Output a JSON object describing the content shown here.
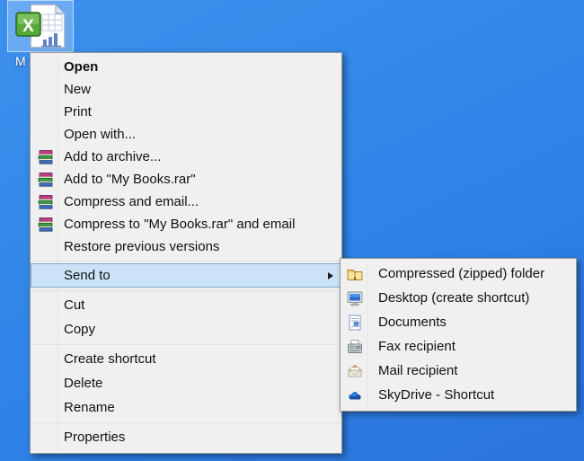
{
  "desktop": {
    "icon_label_visible": "M",
    "icon_type": "excel-document",
    "background_blue": "#2f85e8"
  },
  "colors": {
    "menu_background": "#f1f0f0",
    "menu_border": "#979797",
    "highlight_fill": "#cbe2f7",
    "highlight_border": "#7fa8d0",
    "selection_fill": "rgba(160,205,250,0.45)"
  },
  "context_menu": {
    "items": [
      {
        "label": "Open",
        "bold": true
      },
      {
        "label": "New"
      },
      {
        "label": "Print"
      },
      {
        "label": "Open with..."
      },
      {
        "label": "Add to archive...",
        "icon": "winrar-books-icon"
      },
      {
        "label": "Add to \"My Books.rar\"",
        "icon": "winrar-books-icon"
      },
      {
        "label": "Compress and email...",
        "icon": "winrar-books-icon"
      },
      {
        "label": "Compress to \"My Books.rar\" and email",
        "icon": "winrar-books-icon"
      },
      {
        "label": "Restore previous versions"
      },
      {
        "type": "separator"
      },
      {
        "label": "Send to",
        "highlighted": true,
        "has_submenu": true
      },
      {
        "type": "separator"
      },
      {
        "label": "Cut"
      },
      {
        "label": "Copy"
      },
      {
        "type": "separator"
      },
      {
        "label": "Create shortcut"
      },
      {
        "label": "Delete"
      },
      {
        "label": "Rename"
      },
      {
        "type": "separator"
      },
      {
        "label": "Properties"
      }
    ]
  },
  "submenu": {
    "items": [
      {
        "label": "Compressed (zipped) folder",
        "icon": "zip-folder-icon"
      },
      {
        "label": "Desktop (create shortcut)",
        "icon": "desktop-monitor-icon"
      },
      {
        "label": "Documents",
        "icon": "document-icon"
      },
      {
        "label": "Fax recipient",
        "icon": "fax-icon"
      },
      {
        "label": "Mail recipient",
        "icon": "mail-envelope-icon"
      },
      {
        "label": "SkyDrive - Shortcut",
        "icon": "skydrive-cloud-icon"
      }
    ]
  }
}
